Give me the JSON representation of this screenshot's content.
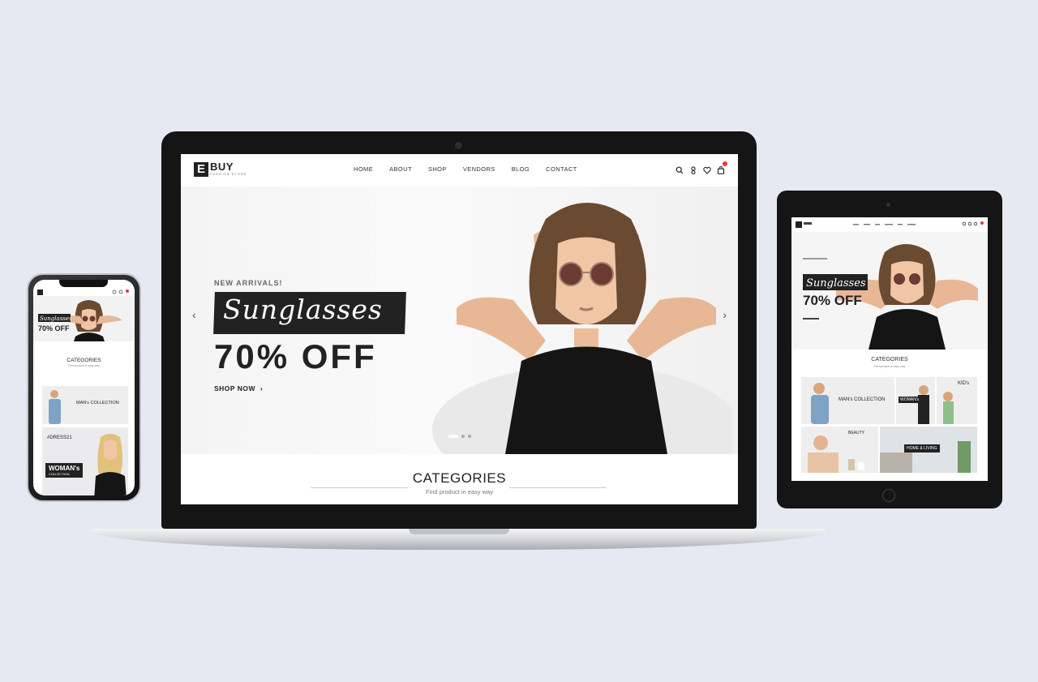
{
  "brand": {
    "logo_letter": "E",
    "name": "BUY",
    "tagline": "FASHION STORE"
  },
  "nav": {
    "items": [
      "HOME",
      "ABOUT",
      "SHOP",
      "VENDORS",
      "BLOG",
      "CONTACT"
    ],
    "icons": [
      "search-icon",
      "user-icon",
      "heart-icon",
      "cart-icon"
    ]
  },
  "hero": {
    "kicker": "NEW ARRIVALS!",
    "product": "Sunglasses",
    "offer": "70% OFF",
    "cta": "SHOP NOW",
    "slides": 3,
    "active_slide": 1
  },
  "categories": {
    "title": "CATEGORIES",
    "subtitle": "Find product in easy way"
  },
  "tablet": {
    "categories_title": "CATEGORIES",
    "tiles": [
      "MAN's COLLECTION",
      "WOMAN's",
      "KID's",
      "BEAUTY",
      "HOME & LIVING"
    ]
  },
  "phone": {
    "categories_title": "CATEGORIES",
    "tile_man": "MAN's COLLECTION",
    "tile_woman_tag": "#DRESS21",
    "tile_woman": "WOMAN's",
    "tile_woman_sub": "COLLECTION"
  },
  "colors": {
    "background": "#e6e9f2",
    "dark": "#222222",
    "accent": "#e53935"
  }
}
